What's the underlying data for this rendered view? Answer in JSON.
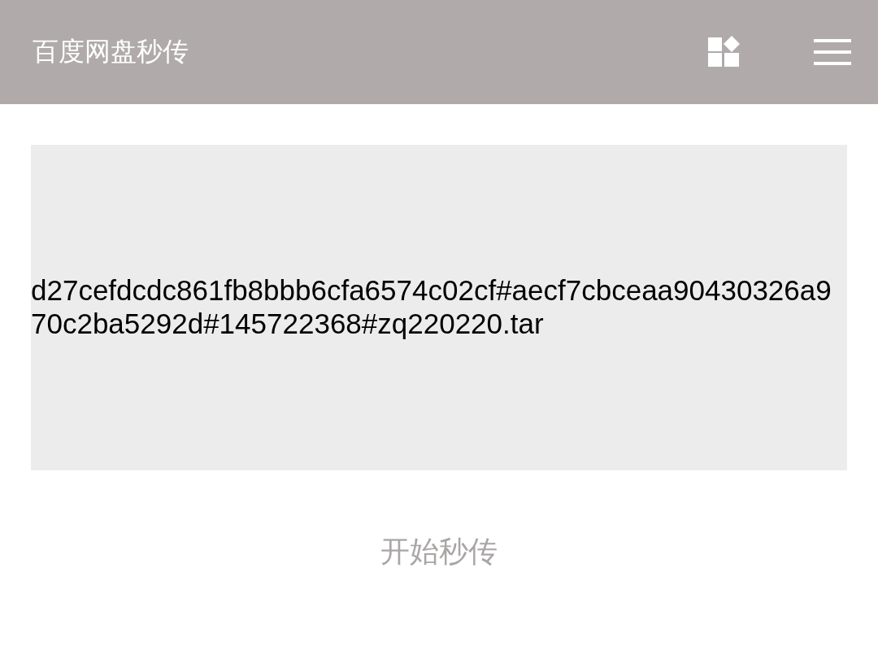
{
  "header": {
    "title": "百度网盘秒传"
  },
  "input": {
    "value": "d27cefdcdc861fb8bbb6cfa6574c02cf#aecf7cbceaa90430326a970c2ba5292d#145722368#zq220220.tar"
  },
  "button": {
    "label": "开始秒传"
  }
}
